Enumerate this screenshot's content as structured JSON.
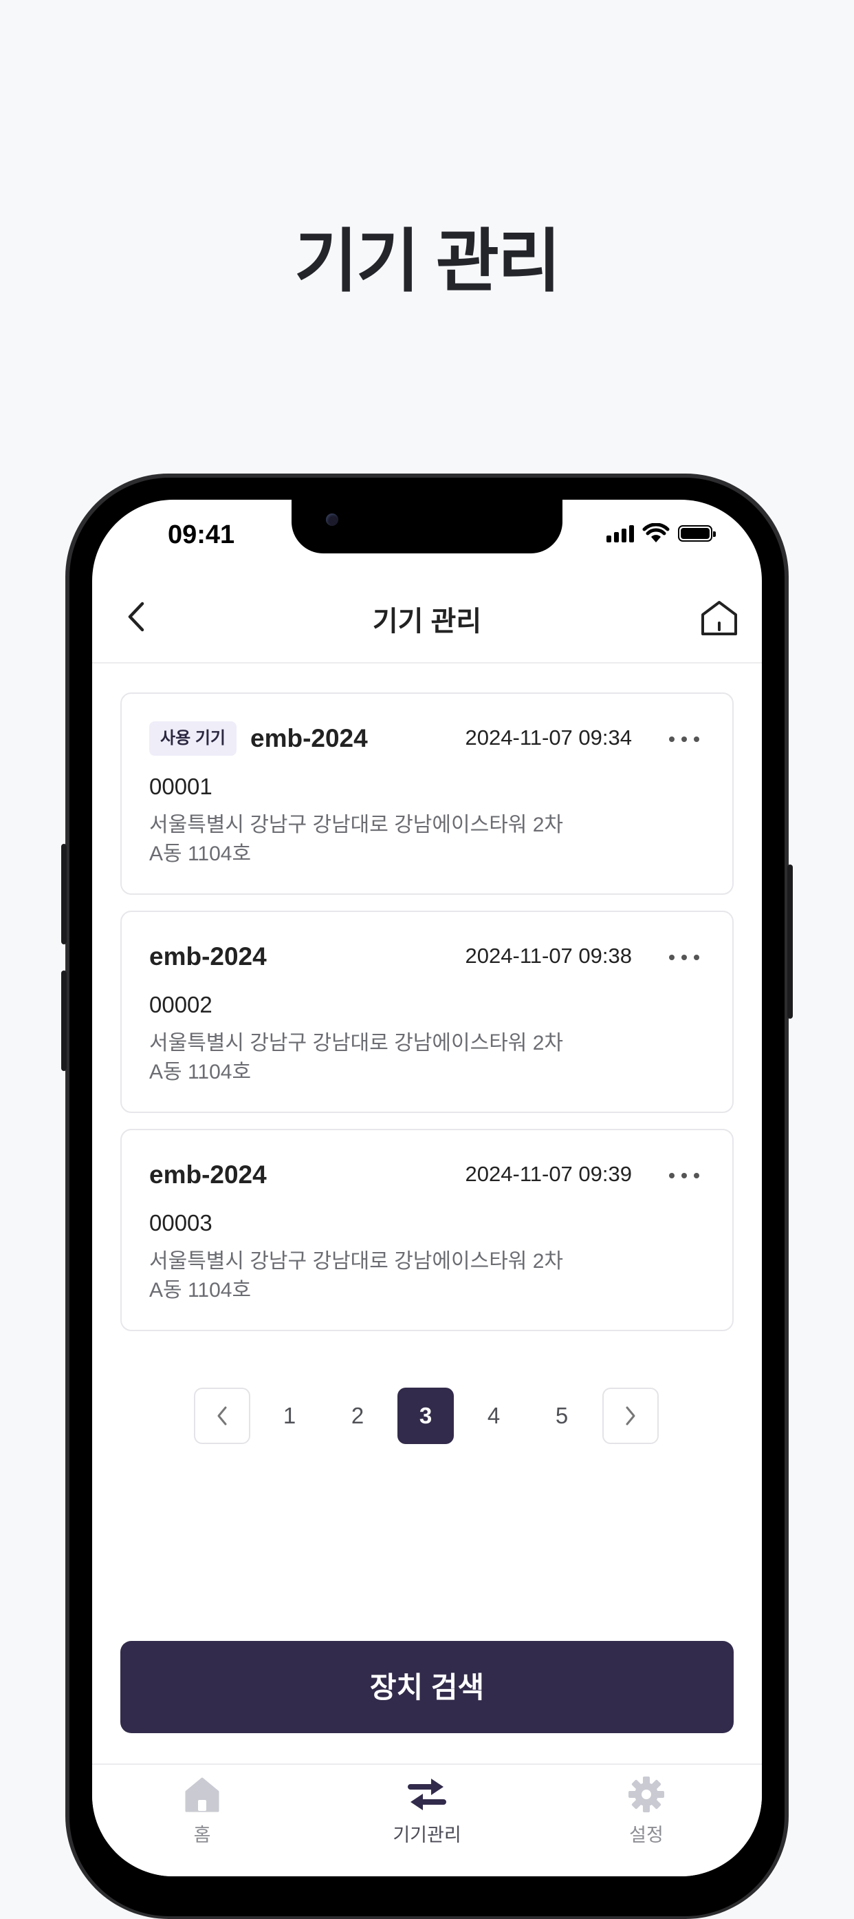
{
  "page": {
    "title": "기기 관리"
  },
  "status_bar": {
    "time": "09:41"
  },
  "header": {
    "title": "기기 관리"
  },
  "devices": [
    {
      "badge": "사용 기기",
      "name": "emb-2024",
      "time": "2024-11-07 09:34",
      "serial": "00001",
      "address_line1": "서울특별시 강남구 강남대로 강남에이스타워 2차",
      "address_line2": "A동 1104호"
    },
    {
      "badge": "",
      "name": "emb-2024",
      "time": "2024-11-07 09:38",
      "serial": "00002",
      "address_line1": "서울특별시 강남구 강남대로 강남에이스타워 2차",
      "address_line2": "A동 1104호"
    },
    {
      "badge": "",
      "name": "emb-2024",
      "time": "2024-11-07 09:39",
      "serial": "00003",
      "address_line1": "서울특별시 강남구 강남대로 강남에이스타워 2차",
      "address_line2": "A동 1104호"
    }
  ],
  "pagination": {
    "pages": [
      "1",
      "2",
      "3",
      "4",
      "5"
    ],
    "current": "3"
  },
  "actions": {
    "search_label": "장치 검색"
  },
  "tabbar": {
    "items": [
      {
        "label": "홈",
        "icon": "home-icon"
      },
      {
        "label": "기기관리",
        "icon": "swap-arrows-icon"
      },
      {
        "label": "설정",
        "icon": "gear-icon"
      }
    ]
  },
  "colors": {
    "primary": "#332b4b",
    "badge_bg": "#efedf8",
    "background": "#f7f8fa"
  }
}
